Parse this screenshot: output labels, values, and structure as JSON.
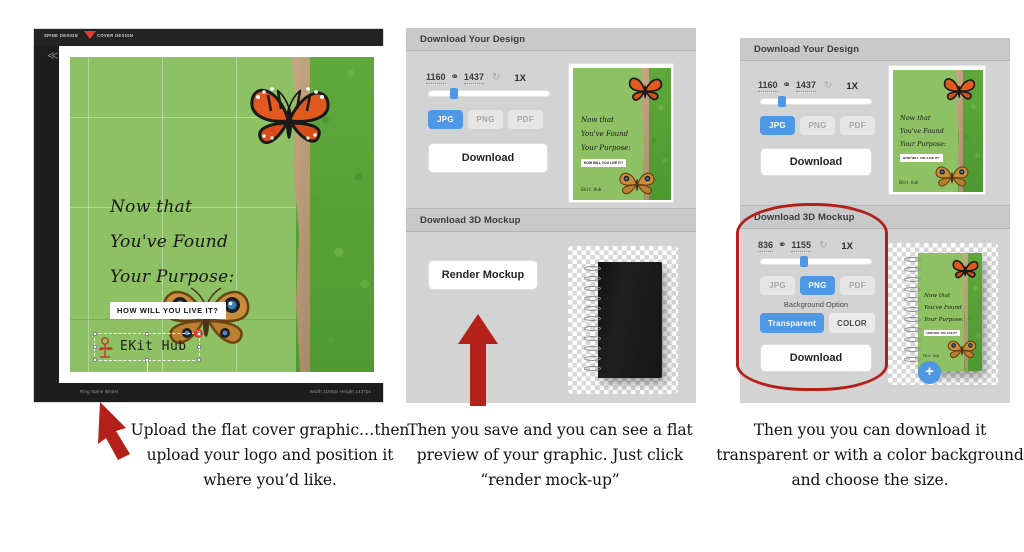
{
  "panel1": {
    "tabs": {
      "spine": "SPINE DESIGN",
      "cover": "COVER DESIGN"
    },
    "back_icon": "≪",
    "cover": {
      "line1": "Now that",
      "line2": "You've Found",
      "line3": "Your Purpose:",
      "tagline": "HOW WILL YOU LIVE IT?",
      "bg_color": "#8ec163"
    },
    "logo": {
      "text": "EKit Hub",
      "delete_icon": "×",
      "rotate_icon": "⟳"
    },
    "status_left": "Ring Spine Binder",
    "status_right": "Width 1160px Height 1437px"
  },
  "panel2": {
    "design_section": {
      "title": "Download Your Design",
      "width": "1160",
      "height": "1437",
      "link_icon": "⚭",
      "refresh_icon": "↻",
      "zoom": "1X",
      "formats": [
        {
          "label": "JPG",
          "active": true
        },
        {
          "label": "PNG",
          "active": false
        },
        {
          "label": "PDF",
          "active": false
        }
      ],
      "download_label": "Download"
    },
    "mockup_section": {
      "title": "Download 3D Mockup",
      "render_label": "Render Mockup"
    }
  },
  "panel3": {
    "design_section": {
      "title": "Download Your Design",
      "width": "1160",
      "height": "1437",
      "link_icon": "⚭",
      "refresh_icon": "↻",
      "zoom": "1X",
      "formats": [
        {
          "label": "JPG",
          "active": true
        },
        {
          "label": "PNG",
          "active": false
        },
        {
          "label": "PDF",
          "active": false
        }
      ],
      "download_label": "Download"
    },
    "mockup_section": {
      "title": "Download 3D Mockup",
      "width": "836",
      "height": "1155",
      "link_icon": "⚭",
      "refresh_icon": "↻",
      "zoom": "1X",
      "formats": [
        {
          "label": "JPG",
          "active": false
        },
        {
          "label": "PNG",
          "active": true
        },
        {
          "label": "PDF",
          "active": false
        }
      ],
      "bg_option_label": "Background Option",
      "bg_options": [
        {
          "label": "Transparent",
          "active": true
        },
        {
          "label": "COLOR",
          "active": false
        }
      ],
      "download_label": "Download",
      "add_icon": "+"
    }
  },
  "captions": {
    "one": "Upload the flat cover graphic…then upload your logo and position it where you’d like.",
    "two": "Then you save and you can see a flat preview of your graphic. Just click “render mock-up”",
    "three": "Then you you can download it transparent or with a color background and choose the size."
  },
  "colors": {
    "accent_blue": "#4e97e5",
    "annotation_red": "#b32119",
    "cover_green": "#8ec163",
    "panel_gray": "#d3d3d3"
  }
}
